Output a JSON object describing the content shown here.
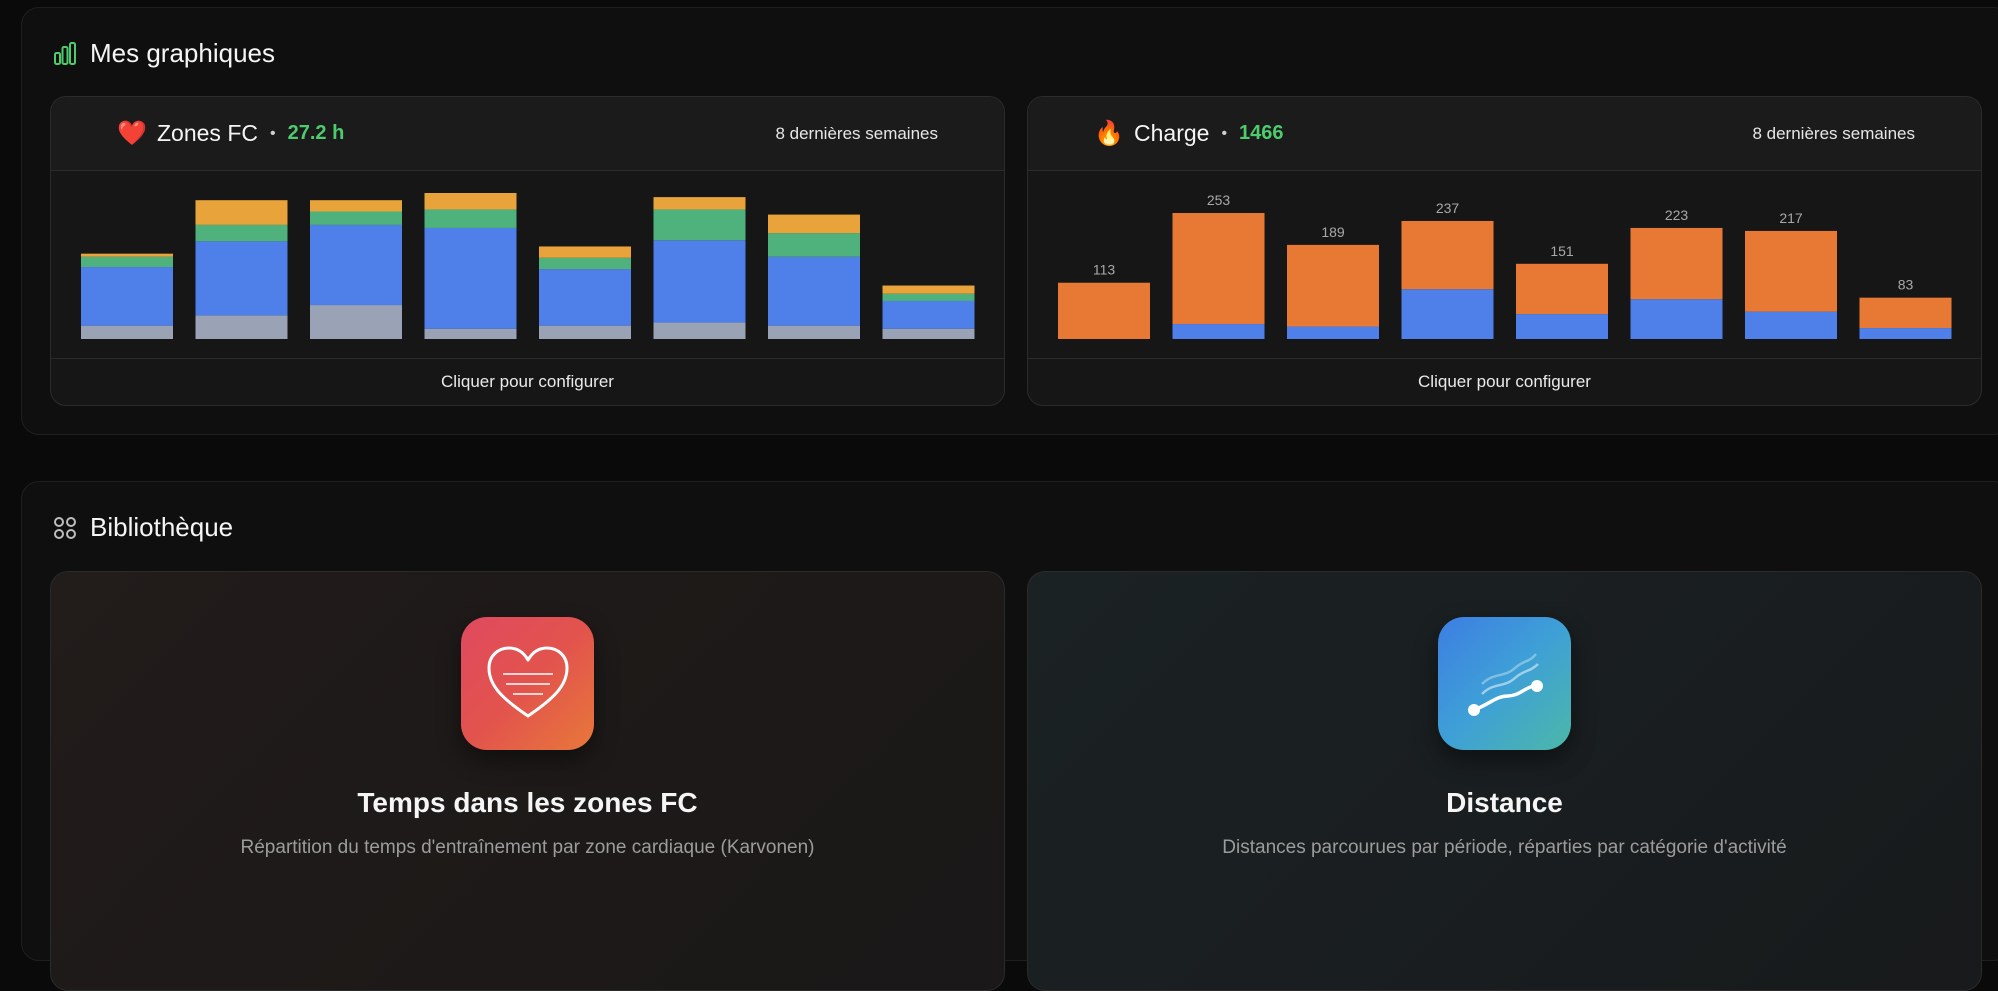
{
  "sections": {
    "charts": {
      "title": "Mes graphiques",
      "icon": "bar-chart-icon"
    },
    "library": {
      "title": "Bibliothèque",
      "icon": "grid-icon"
    }
  },
  "colors": {
    "blue": "#4f7fe8",
    "green": "#4fb27c",
    "orange_zone": "#e8a33a",
    "gray": "#9aa3b5",
    "charge_orange": "#e87935",
    "metric_green": "#4ecb6d"
  },
  "cards": [
    {
      "emoji": "❤️",
      "icon": "heart-icon",
      "title": "Zones FC",
      "metric": "27.2 h",
      "period": "8 dernières semaines",
      "footer": "Cliquer pour configurer"
    },
    {
      "emoji": "🔥",
      "icon": "fire-icon",
      "title": "Charge",
      "metric": "1466",
      "period": "8 dernières semaines",
      "footer": "Cliquer pour configurer"
    }
  ],
  "chart_data": [
    {
      "type": "bar",
      "stacked": true,
      "title": "Zones FC",
      "categories": [
        "",
        "",
        "",
        "",
        "",
        "",
        "",
        ""
      ],
      "series": [
        {
          "color": "#9aa3b5",
          "values": [
            1.3,
            2.3,
            3.3,
            1.0,
            1.3,
            1.6,
            1.3,
            1.0
          ]
        },
        {
          "color": "#4f7fe8",
          "values": [
            5.7,
            7.2,
            7.8,
            9.8,
            5.5,
            8.0,
            6.7,
            2.7
          ]
        },
        {
          "color": "#4fb27c",
          "values": [
            1.0,
            1.6,
            1.3,
            1.8,
            1.1,
            3.0,
            2.3,
            0.7
          ]
        },
        {
          "color": "#e8a33a",
          "values": [
            0.3,
            2.4,
            1.1,
            1.6,
            1.1,
            1.2,
            1.8,
            0.8
          ]
        }
      ]
    },
    {
      "type": "bar",
      "stacked": true,
      "title": "Charge",
      "categories": [
        "",
        "",
        "",
        "",
        "",
        "",
        "",
        ""
      ],
      "totals": [
        113,
        253,
        189,
        237,
        151,
        223,
        217,
        83
      ],
      "series": [
        {
          "color": "#4f7fe8",
          "values": [
            0,
            30,
            25,
            100,
            50,
            80,
            55,
            22
          ]
        },
        {
          "color": "#e87935",
          "values": [
            113,
            223,
            164,
            137,
            101,
            143,
            162,
            61
          ]
        }
      ]
    }
  ],
  "library": [
    {
      "icon": "heart-lines-icon",
      "title": "Temps dans les zones FC",
      "description": "Répartition du temps d'entraînement par zone cardiaque (Karvonen)"
    },
    {
      "icon": "distance-route-icon",
      "title": "Distance",
      "description": "Distances parcourues par période, réparties par catégorie d'activité"
    }
  ]
}
